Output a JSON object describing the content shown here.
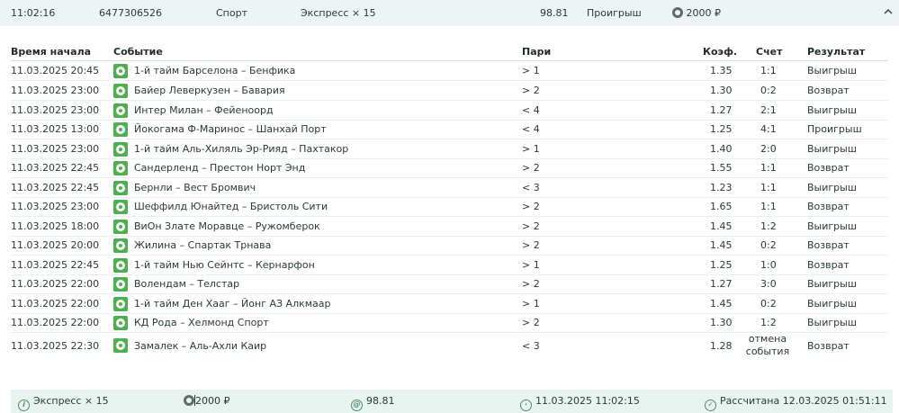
{
  "summary": {
    "time": "11:02:16",
    "bet_id": "6477306526",
    "sport": "Спорт",
    "type": "Экспресс × 15",
    "odds": "98.81",
    "status": "Проигрыш",
    "stake": "2000 ₽"
  },
  "headers": {
    "start_time": "Время начала",
    "event": "Событие",
    "bet": "Пари",
    "coef": "Коэф.",
    "score": "Счет",
    "result": "Результат"
  },
  "rows": [
    {
      "time": "11.03.2025 20:45",
      "event": "1-й тайм Барселона – Бенфика",
      "bet": "> 1",
      "coef": "1.35",
      "score": "1:1",
      "result": "Выигрыш"
    },
    {
      "time": "11.03.2025 23:00",
      "event": "Байер Леверкузен – Бавария",
      "bet": "> 2",
      "coef": "1.30",
      "score": "0:2",
      "result": "Возврат"
    },
    {
      "time": "11.03.2025 23:00",
      "event": "Интер Милан – Фейеноорд",
      "bet": "< 4",
      "coef": "1.27",
      "score": "2:1",
      "result": "Выигрыш"
    },
    {
      "time": "11.03.2025 13:00",
      "event": "Йокогама Ф-Маринос – Шанхай Порт",
      "bet": "< 4",
      "coef": "1.25",
      "score": "4:1",
      "result": "Проигрыш"
    },
    {
      "time": "11.03.2025 23:00",
      "event": "1-й тайм Аль-Хиляль Эр-Рияд – Пахтакор",
      "bet": "> 1",
      "coef": "1.40",
      "score": "2:0",
      "result": "Выигрыш"
    },
    {
      "time": "11.03.2025 22:45",
      "event": "Сандерленд – Престон Норт Энд",
      "bet": "> 2",
      "coef": "1.55",
      "score": "1:1",
      "result": "Возврат"
    },
    {
      "time": "11.03.2025 22:45",
      "event": "Бернли – Вест Бромвич",
      "bet": "< 3",
      "coef": "1.23",
      "score": "1:1",
      "result": "Выигрыш"
    },
    {
      "time": "11.03.2025 23:00",
      "event": "Шеффилд Юнайтед – Бристоль Сити",
      "bet": "> 2",
      "coef": "1.65",
      "score": "1:1",
      "result": "Возврат"
    },
    {
      "time": "11.03.2025 18:00",
      "event": "ВиОн Злате Моравце – Ружомберок",
      "bet": "> 2",
      "coef": "1.45",
      "score": "1:2",
      "result": "Выигрыш"
    },
    {
      "time": "11.03.2025 20:00",
      "event": "Жилина – Спартак Трнава",
      "bet": "> 2",
      "coef": "1.45",
      "score": "0:2",
      "result": "Возврат"
    },
    {
      "time": "11.03.2025 22:45",
      "event": "1-й тайм Нью Сейнтс – Кернарфон",
      "bet": "> 1",
      "coef": "1.25",
      "score": "1:0",
      "result": "Возврат"
    },
    {
      "time": "11.03.2025 22:00",
      "event": "Волендам – Телстар",
      "bet": "> 2",
      "coef": "1.27",
      "score": "3:0",
      "result": "Выигрыш"
    },
    {
      "time": "11.03.2025 22:00",
      "event": "1-й тайм Ден Хааг – Йонг АЗ Алкмаар",
      "bet": "> 1",
      "coef": "1.45",
      "score": "0:2",
      "result": "Выигрыш"
    },
    {
      "time": "11.03.2025 22:00",
      "event": "КД Рода – Хелмонд Спорт",
      "bet": "> 2",
      "coef": "1.30",
      "score": "1:2",
      "result": "Выигрыш"
    },
    {
      "time": "11.03.2025 22:30",
      "event": "Замалек – Аль-Ахли Каир",
      "bet": "< 3",
      "coef": "1.28",
      "score": "отмена события",
      "result": "Возврат"
    }
  ],
  "footer": {
    "type": "Экспресс × 15",
    "stake": "2000 ₽",
    "odds": "98.81",
    "placed_at": "11.03.2025 11:02:15",
    "settled": "Рассчитана 12.03.2025 01:51:11"
  },
  "colors": {
    "accent": "#4caf50",
    "summary_bg": "#eef3f6",
    "footer_bg": "#e8f3ef"
  },
  "icons": {
    "sport": "soccer-ball-icon",
    "collapse": "chevron-up-icon",
    "stake": "coin-icon"
  }
}
